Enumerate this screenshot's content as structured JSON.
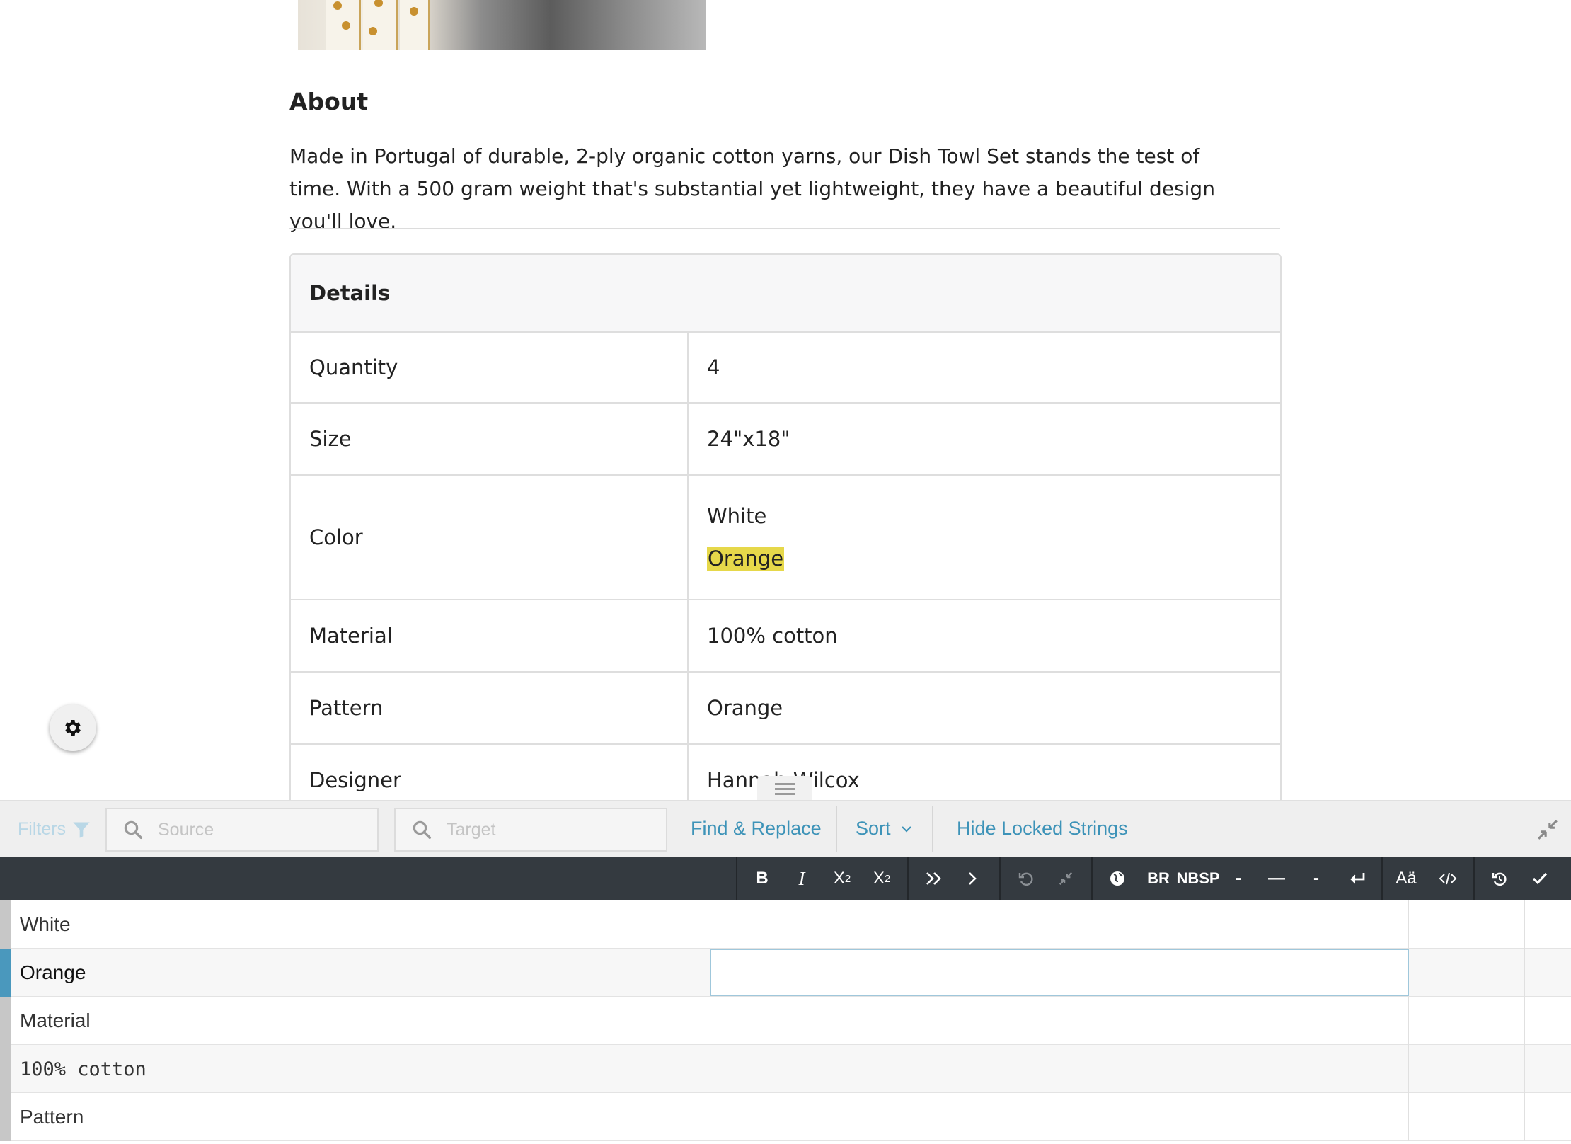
{
  "about": {
    "heading": "About",
    "paragraph": "Made in Portugal of durable, 2-ply organic cotton yarns, our Dish Towl Set stands the test of time. With a 500 gram weight that's substantial yet lightweight, they have a beautiful design you'll love."
  },
  "details": {
    "heading": "Details",
    "rows": [
      {
        "key": "Quantity",
        "value": "4"
      },
      {
        "key": "Size",
        "value": "24\"x18\""
      },
      {
        "key": "Color",
        "value": "White",
        "value2": "Orange"
      },
      {
        "key": "Material",
        "value": "100% cotton"
      },
      {
        "key": "Pattern",
        "value": "Orange"
      },
      {
        "key": "Designer",
        "value": "Hannah Wilcox"
      }
    ]
  },
  "toolbar": {
    "filters_label": "Filters",
    "source_placeholder": "Source",
    "target_placeholder": "Target",
    "find_replace": "Find & Replace",
    "sort": "Sort",
    "hide_locked": "Hide Locked Strings"
  },
  "format_bar": {
    "bold": "B",
    "italic": "I",
    "superscript": "X",
    "superscript_mark": "2",
    "subscript": "X",
    "subscript_mark": "2",
    "br": "BR",
    "nbsp": "NBSP",
    "hyphen": "-",
    "em_dash": "—",
    "en_dash": "-",
    "case": "Aä"
  },
  "strings": [
    {
      "source": "White"
    },
    {
      "source": "Orange"
    },
    {
      "source": "Material"
    },
    {
      "source": "100% cotton"
    },
    {
      "source": "Pattern"
    }
  ],
  "colors": {
    "accent": "#3d93b8",
    "highlight": "#e6d84a",
    "format_bar": "#343a40",
    "active_marker": "#4a98bd"
  }
}
